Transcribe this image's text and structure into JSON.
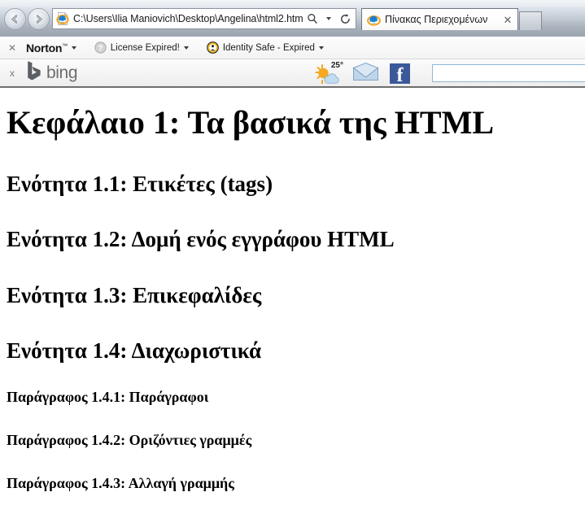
{
  "browser": {
    "back_label": "Back",
    "forward_label": "Forward",
    "address_value": "C:\\Users\\Ilia Maniovich\\Desktop\\Angelina\\html2.htm",
    "address_placeholder": "",
    "search_icon": "search-icon",
    "search_dropdown_icon": "chevron-down-icon",
    "refresh_icon": "refresh-icon",
    "favicon": "internet-explorer-icon",
    "tab": {
      "title": "Πίνακας Περιεχομένων",
      "favicon": "internet-explorer-icon",
      "close_label": "✕"
    },
    "new_tab_label": ""
  },
  "norton_bar": {
    "close_label": "✕",
    "brand": "Norton",
    "brand_tm": "™",
    "brand_caret_icon": "chevron-down-icon",
    "items": [
      {
        "label": "License Expired!",
        "icon": "question-circle-icon",
        "caret_icon": "chevron-down-icon"
      },
      {
        "label": "Identity Safe - Expired",
        "icon": "identity-safe-icon",
        "caret_icon": "chevron-down-icon"
      }
    ]
  },
  "bing_bar": {
    "close_label": "x",
    "logo_text": "bing",
    "logo_icon": "bing-logo-icon",
    "weather": {
      "temperature": "25°",
      "icon": "sun-cloud-icon"
    },
    "mail_icon": "envelope-icon",
    "facebook_icon": "facebook-icon",
    "facebook_letter": "f",
    "search_value": "",
    "search_placeholder": ""
  },
  "document": {
    "title": "Κεφάλαιο 1: Τα βασικά της HTML",
    "sections": [
      {
        "level": 2,
        "text": "Ενότητα 1.1: Ετικέτες (tags)"
      },
      {
        "level": 2,
        "text": "Ενότητα 1.2: Δομή ενός εγγράφου HTML"
      },
      {
        "level": 2,
        "text": "Ενότητα 1.3: Επικεφαλίδες"
      },
      {
        "level": 2,
        "text": "Ενότητα 1.4: Διαχωριστικά"
      },
      {
        "level": 3,
        "text": "Παράγραφος 1.4.1: Παράγραφοι"
      },
      {
        "level": 3,
        "text": "Παράγραφος 1.4.2: Οριζόντιες γραμμές"
      },
      {
        "level": 3,
        "text": "Παράγραφος 1.4.3: Αλλαγή γραμμής"
      }
    ]
  },
  "colors": {
    "facebook_blue": "#3b5998",
    "bing_grey": "#6d6d6d",
    "identity_safe_gold": "#f0b823",
    "page_background": "#ffffff",
    "text": "#000000"
  }
}
